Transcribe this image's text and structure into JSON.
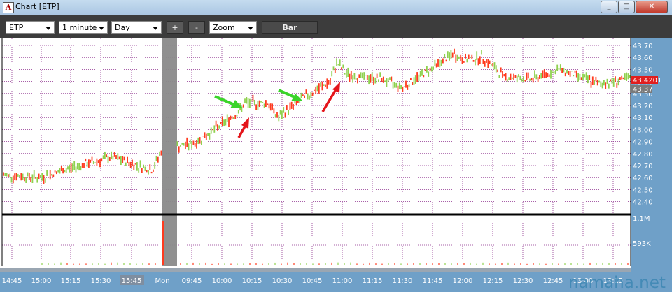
{
  "window": {
    "title": "Chart [ETP]",
    "app_icon_letter": "A"
  },
  "toolbar": {
    "symbol": "ETP",
    "interval": "1 minute",
    "period": "Day",
    "plus_label": "+",
    "minus_label": "-",
    "zoom_label": "Zoom",
    "style_label": "Bar"
  },
  "price_axis": {
    "labels": [
      "43.70",
      "43.60",
      "43.50",
      "43.40",
      "43.30",
      "43.20",
      "43.10",
      "43.00",
      "42.90",
      "42.80",
      "42.70",
      "42.60",
      "42.50",
      "42.40"
    ],
    "last_price": "43.4201",
    "last_price_color": "#e01e1e",
    "bid_label": "43.37"
  },
  "volume_axis": {
    "labels": [
      "1.1M",
      "593K"
    ]
  },
  "time_axis": {
    "labels": [
      "14:45",
      "15:00",
      "15:15",
      "15:30",
      "15:45",
      "Mon",
      "09:45",
      "10:00",
      "10:15",
      "10:30",
      "10:45",
      "11:00",
      "11:15",
      "11:30",
      "11:45",
      "12:00",
      "12:15",
      "12:30",
      "12:45",
      "13:00",
      "13:15"
    ],
    "highlight_label": "15:45"
  },
  "annotations": {
    "up_arrows": [
      "green-arrow-1",
      "green-arrow-2"
    ],
    "down_arrows": [
      "red-arrow-1",
      "red-arrow-2"
    ]
  },
  "colors": {
    "up_bar": "#8fd14f",
    "down_bar": "#ff3b1f",
    "accent": "#ff7a1a"
  },
  "chart_data": {
    "type": "line",
    "title": "",
    "xlabel": "",
    "ylabel": "",
    "ylim": [
      42.4,
      43.75
    ],
    "x": [
      "14:45",
      "15:00",
      "15:15",
      "15:30",
      "15:45",
      "09:35",
      "09:45",
      "10:00",
      "10:05",
      "10:15",
      "10:20",
      "10:30",
      "10:40",
      "10:45",
      "10:50",
      "11:00",
      "11:15",
      "11:30",
      "11:45",
      "11:50",
      "12:00",
      "12:15",
      "12:30",
      "12:45",
      "13:00",
      "13:15"
    ],
    "series": [
      {
        "values": [
          42.62,
          42.6,
          42.68,
          42.77,
          42.66,
          42.83,
          42.89,
          43.15,
          43.22,
          43.22,
          43.1,
          43.25,
          43.4,
          43.56,
          43.46,
          43.44,
          43.42,
          43.35,
          43.63,
          43.58,
          43.6,
          43.44,
          43.42,
          43.5,
          43.38,
          43.42
        ]
      }
    ],
    "volume_ylim": [
      0,
      1100000
    ]
  }
}
